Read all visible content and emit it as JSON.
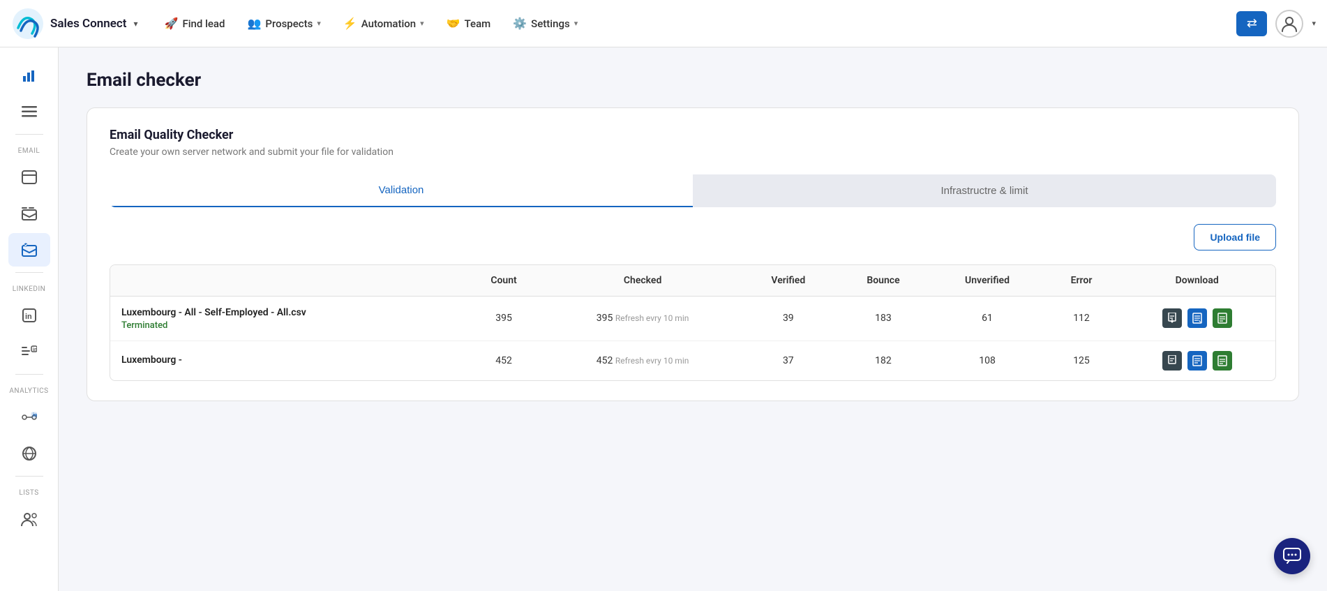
{
  "app": {
    "logo_text": "Sales Connect",
    "logo_chevron": "▾"
  },
  "nav": {
    "find_lead": "Find lead",
    "prospects": "Prospects",
    "automation": "Automation",
    "team": "Team",
    "settings": "Settings"
  },
  "sidebar": {
    "section_email": "EMAIL",
    "section_linkedin": "LINKEDIN",
    "section_analytics": "ANALYTICS",
    "section_lists": "LISTS"
  },
  "page": {
    "title": "Email checker"
  },
  "card": {
    "title": "Email Quality Checker",
    "subtitle": "Create your own server network and submit your file for validation"
  },
  "tabs": {
    "validation": "Validation",
    "infrastructure": "Infrastructre & limit"
  },
  "buttons": {
    "upload_file": "Upload file"
  },
  "table": {
    "headers": [
      "",
      "Count",
      "Checked",
      "Verified",
      "Bounce",
      "Unverified",
      "Error",
      "Download"
    ],
    "rows": [
      {
        "name": "Luxembourg - All - Self-Employed - All.csv",
        "status": "Terminated",
        "count": 395,
        "checked": 395,
        "checked_note": "Refresh evry 10 min",
        "verified": 39,
        "bounce": 183,
        "unverified": 61,
        "error": 112
      },
      {
        "name": "Luxembourg -",
        "status": "",
        "count": 452,
        "checked": 452,
        "checked_note": "Refresh evry 10 min",
        "verified": 37,
        "bounce": 182,
        "unverified": 108,
        "error": 125
      }
    ]
  }
}
